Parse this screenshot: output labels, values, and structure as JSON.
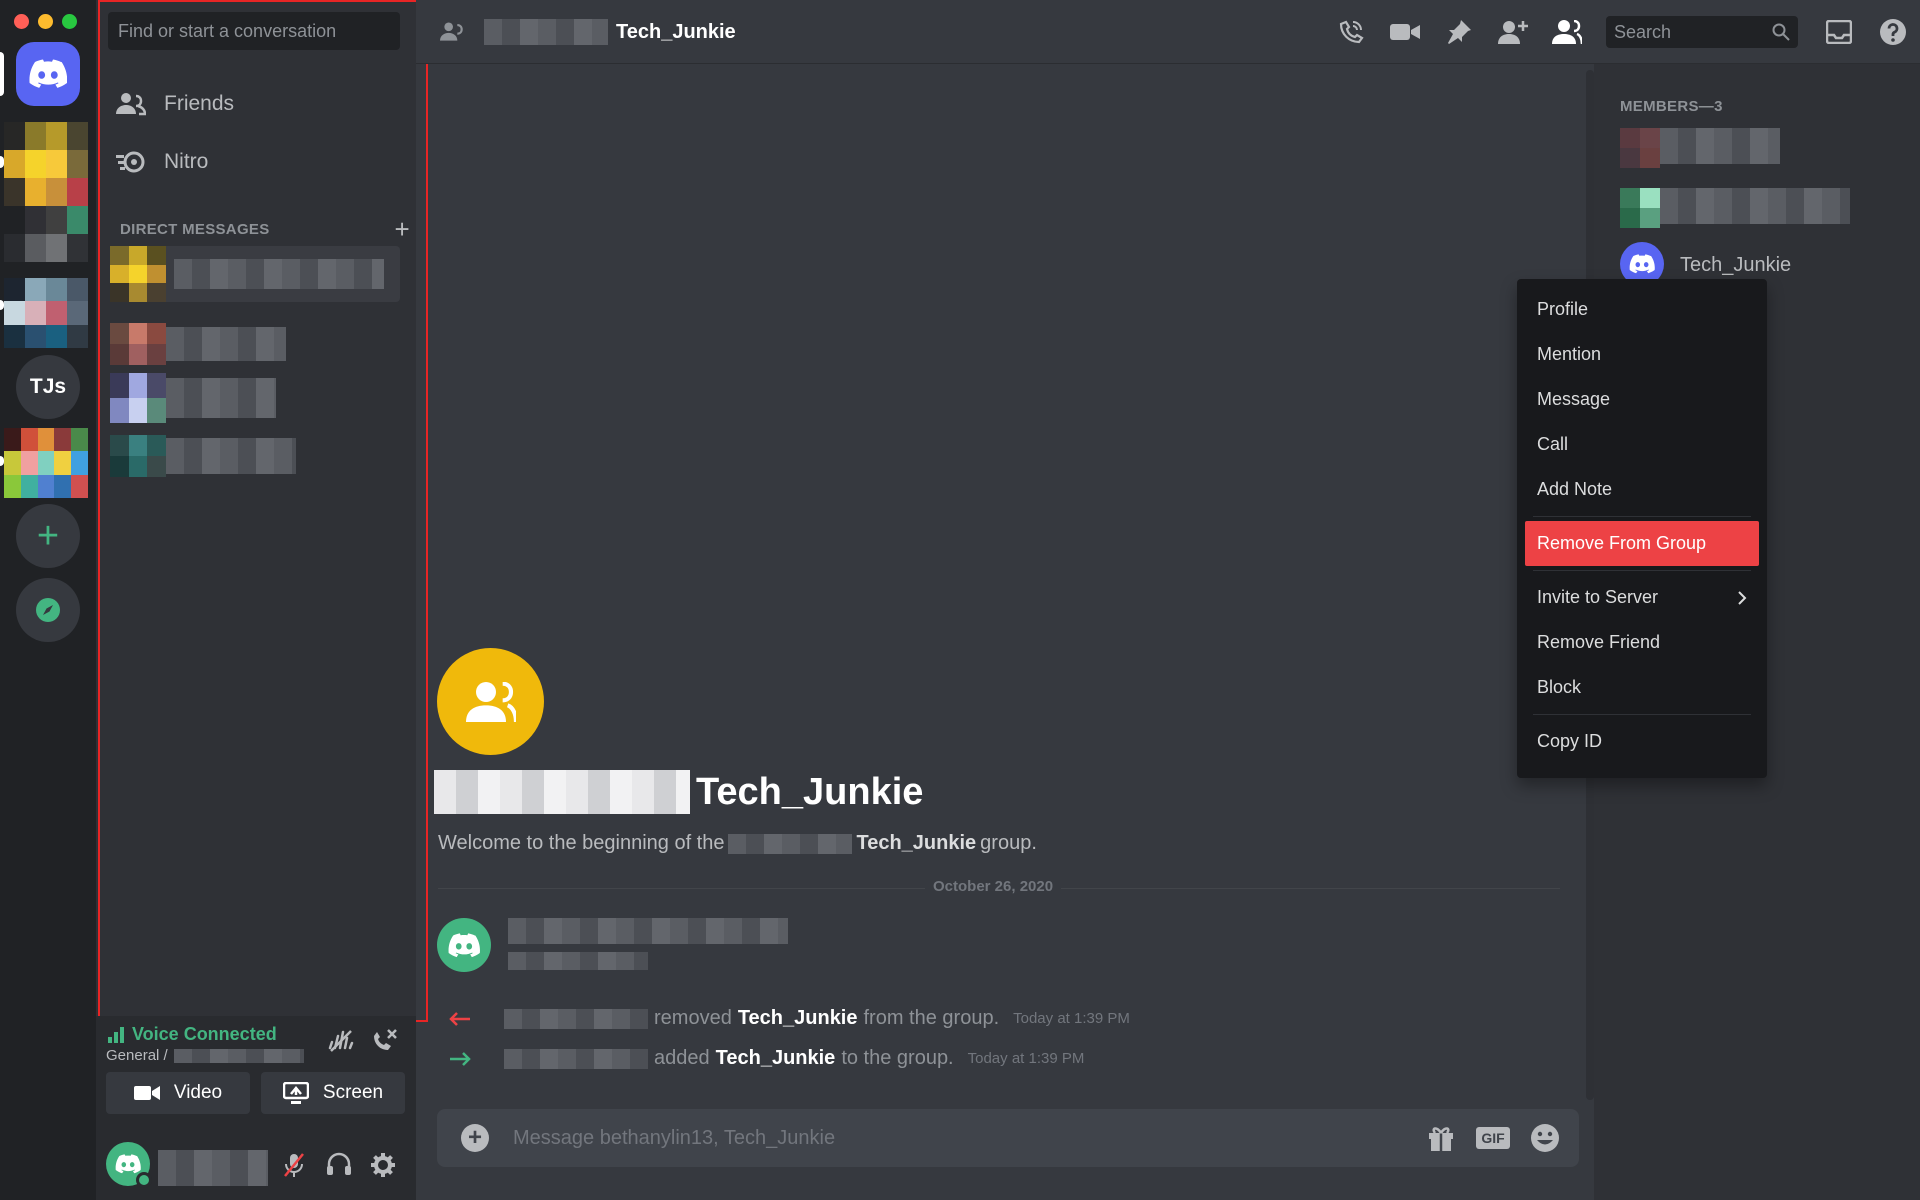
{
  "guilds": {
    "tjs_label": "TJs",
    "add_label": "+"
  },
  "sidebar": {
    "search_placeholder": "Find or start a conversation",
    "friends_label": "Friends",
    "nitro_label": "Nitro",
    "dm_header": "DIRECT MESSAGES",
    "dm_add": "+"
  },
  "voice": {
    "status": "Voice Connected",
    "channel": "General /",
    "video_label": "Video",
    "screen_label": "Screen"
  },
  "topbar": {
    "title": "Tech_Junkie",
    "search_placeholder": "Search"
  },
  "chat": {
    "welcome_title": "Tech_Junkie",
    "welcome_prefix": "Welcome to the beginning of the",
    "welcome_name": "Tech_Junkie",
    "welcome_suffix": "group.",
    "date_divider": "October 26, 2020",
    "system": [
      {
        "action": "removed",
        "name": "Tech_Junkie",
        "rest": "from the group.",
        "time": "Today at 1:39 PM"
      },
      {
        "action": "added",
        "name": "Tech_Junkie",
        "rest": "to the group.",
        "time": "Today at 1:39 PM"
      }
    ],
    "composer_placeholder": "Message bethanylin13, Tech_Junkie",
    "gif_label": "GIF"
  },
  "members": {
    "header": "MEMBERS—3",
    "visible_member": "Tech_Junkie"
  },
  "context_menu": {
    "items": [
      "Profile",
      "Mention",
      "Message",
      "Call",
      "Add Note"
    ],
    "danger": "Remove From Group",
    "items2": [
      "Invite to Server",
      "Remove Friend",
      "Block"
    ],
    "copy_id": "Copy ID"
  },
  "colors": {
    "accent": "#5865f2",
    "green": "#43b581",
    "danger": "#ed4245",
    "group_avatar": "#f0b90b",
    "highlight_outline": "#e82525"
  }
}
